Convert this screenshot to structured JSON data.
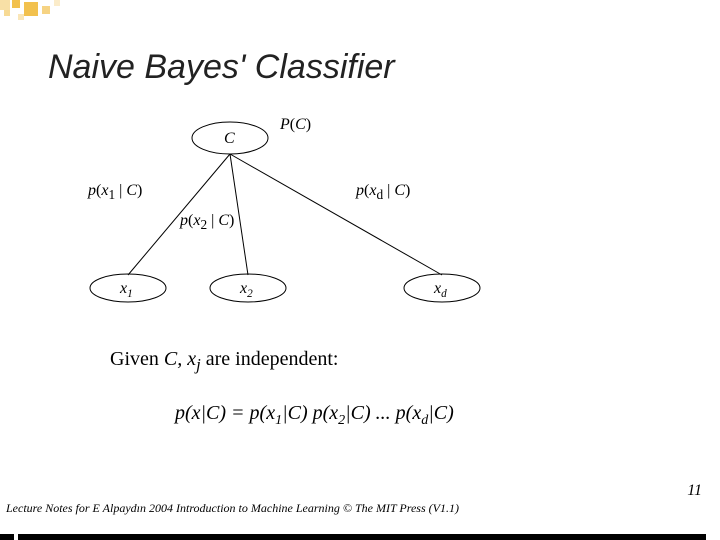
{
  "title": "Naive Bayes' Classifier",
  "diagram": {
    "root": "C",
    "root_prior": "P(C)",
    "children": [
      {
        "name": "x1",
        "name_html": "x<sub>1</sub>",
        "edge": "p(x<sub>1</sub> | C)"
      },
      {
        "name": "x2",
        "name_html": "x<sub>2</sub>",
        "edge": "p(x<sub>2</sub> | C)"
      },
      {
        "name": "xd",
        "name_html": "x<sub>d</sub>",
        "edge": "p(x<sub>d</sub> | C)"
      }
    ]
  },
  "statement_prefix": "Given ",
  "statement_mid": "C, x",
  "statement_sub": "j",
  "statement_suffix": " are independent:",
  "equation": "p(x|C) = p(x<sub>1</sub>|C) p(x<sub>2</sub>|C) ... p(x<sub>d</sub>|C)",
  "footer": "Lecture Notes for E Alpaydın 2004 Introduction to Machine Learning © The MIT Press (V1.1)",
  "page": "11"
}
